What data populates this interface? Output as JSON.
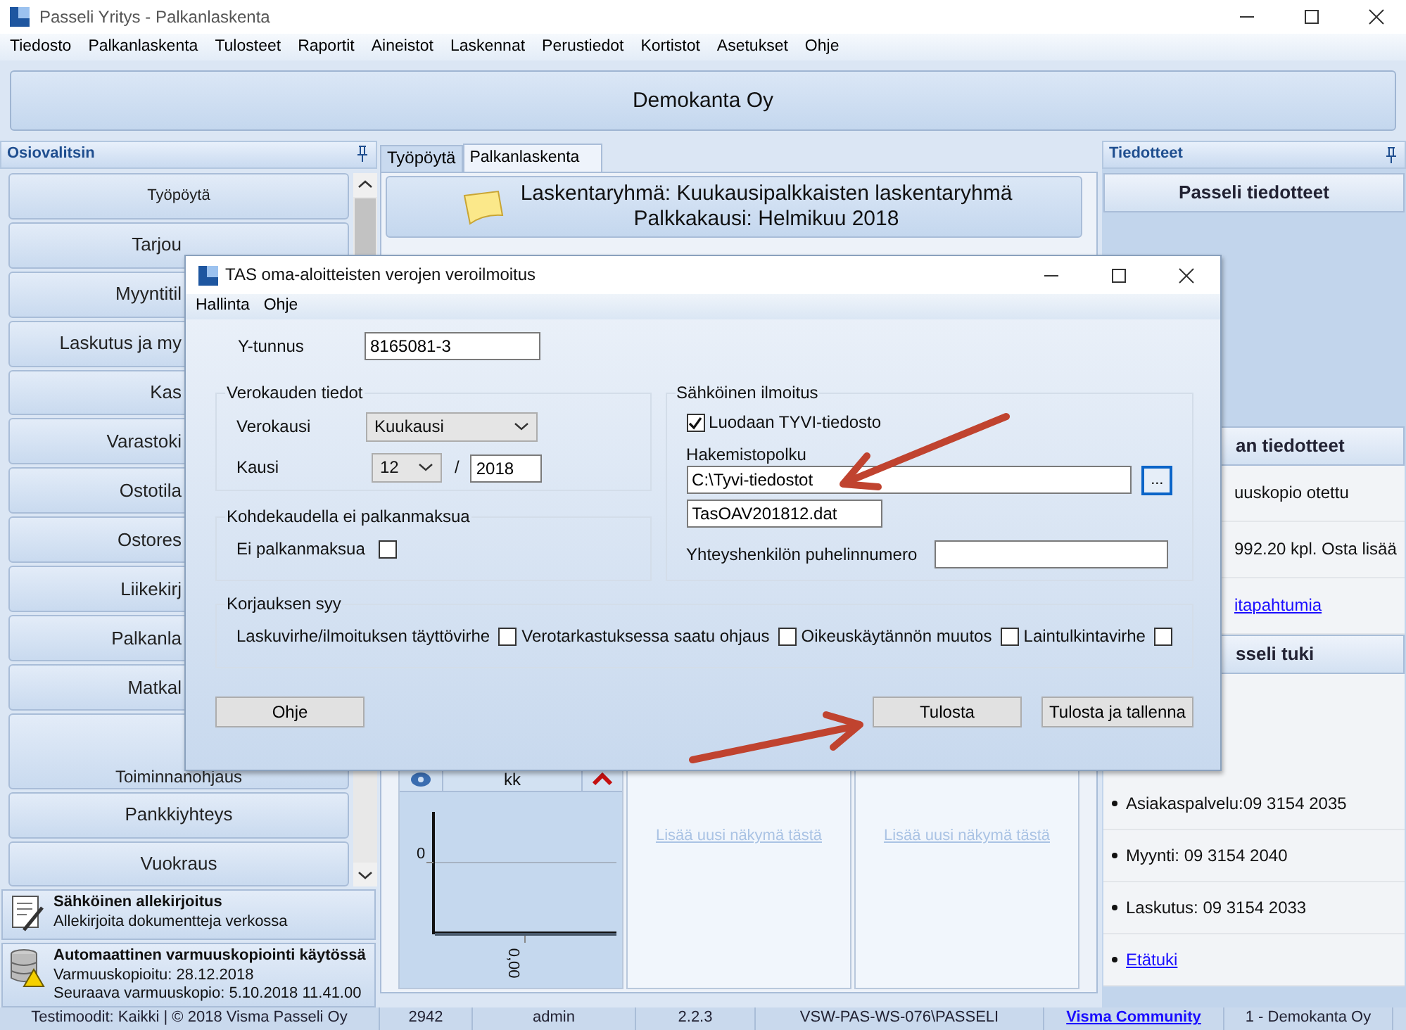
{
  "window": {
    "title": "Passeli Yritys - Palkanlaskenta"
  },
  "menu": [
    "Tiedosto",
    "Palkanlaskenta",
    "Tulosteet",
    "Raportit",
    "Aineistot",
    "Laskennat",
    "Perustiedot",
    "Kortistot",
    "Asetukset",
    "Ohje"
  ],
  "banner": "Demokanta Oy",
  "sidebar": {
    "title": "Osiovalitsin",
    "items": [
      {
        "label": "Työpöytä",
        "kind": "full"
      },
      {
        "label": "Tarjou",
        "kind": "clipped"
      },
      {
        "label": "Myyntitil",
        "kind": "clipped"
      },
      {
        "label": "Laskutus ja my",
        "kind": "clipped"
      },
      {
        "label": "Kas",
        "kind": "clipped"
      },
      {
        "label": "Varastoki",
        "kind": "clipped"
      },
      {
        "label": "Ostotila",
        "kind": "clipped"
      },
      {
        "label": "Ostores",
        "kind": "clipped"
      },
      {
        "label": "Liikekirj",
        "kind": "clipped"
      },
      {
        "label": "Palkanla",
        "kind": "clipped"
      },
      {
        "label": "Matkal",
        "kind": "clipped"
      },
      {
        "label": "Toiminnanohjaus",
        "kind": "clipped_top"
      },
      {
        "label": "Pankkiyhteys",
        "kind": "full"
      },
      {
        "label": "Vuokraus",
        "kind": "full"
      }
    ],
    "notices": [
      {
        "kind": "signature",
        "title": "Sähköinen allekirjoitus",
        "lines": [
          "Allekirjoita dokumentteja verkossa"
        ]
      },
      {
        "kind": "backup",
        "title": "Automaattinen varmuuskopiointi käytössä",
        "lines": [
          "Varmuuskopioitu: 28.12.2018",
          "Seuraava varmuuskopio: 5.10.2018 11.41.00"
        ]
      }
    ]
  },
  "tabs": [
    {
      "label": "Työpöytä",
      "selected": false
    },
    {
      "label": "Palkanlaskenta",
      "selected": true
    }
  ],
  "header": {
    "lines": [
      "Laskentaryhmä: Kuukausipalkkaisten laskentaryhmä",
      "Palkkakausi: Helmikuu 2018"
    ]
  },
  "widgets": [
    {
      "kind": "chart",
      "title": "kk",
      "y_tick": "0",
      "x_label": "0,00"
    },
    {
      "kind": "empty",
      "link": "Lisää uusi näkymä tästä"
    },
    {
      "kind": "empty",
      "link": "Lisää uusi näkymä tästä"
    }
  ],
  "news": {
    "title": "Tiedotteet",
    "sections": [
      {
        "heading": "Passeli tiedotteet",
        "kind": "full"
      },
      {
        "heading": "an tiedotteet",
        "kind": "clipped",
        "rows": [
          {
            "kind": "text",
            "text": "uuskopio otettu"
          },
          {
            "kind": "text",
            "text": "992.20 kpl. Osta lisää"
          },
          {
            "kind": "link",
            "text": "itapahtumia"
          }
        ]
      },
      {
        "heading": "sseli tuki",
        "kind": "clipped",
        "rows": [
          {
            "kind": "bullet",
            "text": "Asiakaspalvelu:09 3154 2035"
          },
          {
            "kind": "bullet",
            "text": "Myynti:  09 3154 2040"
          },
          {
            "kind": "bullet",
            "text": "Laskutus: 09 3154 2033"
          },
          {
            "kind": "bullet_link",
            "text": "Etätuki"
          }
        ]
      }
    ]
  },
  "status_bar": [
    {
      "kind": "text",
      "text": "Testimoodit: Kaikki | © 2018 Visma Passeli Oy"
    },
    {
      "kind": "text",
      "text": "2942"
    },
    {
      "kind": "text",
      "text": "admin"
    },
    {
      "kind": "text",
      "text": "2.2.3"
    },
    {
      "kind": "text",
      "text": "VSW-PAS-WS-076\\PASSELI"
    },
    {
      "kind": "link",
      "text": "Visma Community"
    },
    {
      "kind": "text",
      "text": "1 - Demokanta Oy"
    }
  ],
  "dialog": {
    "title": "TAS oma-aloitteisten verojen veroilmoitus",
    "menu": [
      "Hallinta",
      "Ohje"
    ],
    "business_id": {
      "label": "Y-tunnus",
      "value": "8165081-3"
    },
    "period_group": {
      "title": "Verokauden tiedot",
      "period_type": {
        "label": "Verokausi",
        "value": "Kuukausi"
      },
      "period": {
        "label": "Kausi",
        "month": "12",
        "separator": "/",
        "year": "2018"
      }
    },
    "no_pay_group": {
      "title": "Kohdekaudella ei palkanmaksua",
      "checkbox": {
        "label": "Ei palkanmaksua",
        "checked": false
      }
    },
    "electronic_group": {
      "title": "Sähköinen ilmoitus",
      "create_file": {
        "label": "Luodaan TYVI-tiedosto",
        "checked": true
      },
      "path": {
        "label": "Hakemistopolku",
        "value": "C:\\Tyvi-tiedostot",
        "browse": "..."
      },
      "file_name": "TasOAV201812.dat",
      "phone": {
        "label": "Yhteyshenkilön puhelinnumero"
      }
    },
    "correction_group": {
      "title": "Korjauksen syy",
      "reasons": [
        {
          "label": "Laskuvirhe/ilmoituksen täyttövirhe",
          "checked": false
        },
        {
          "label": "Verotarkastuksessa saatu ohjaus",
          "checked": false
        },
        {
          "label": "Oikeuskäytännön muutos",
          "checked": false
        },
        {
          "label": "Laintulkintavirhe",
          "checked": false
        }
      ]
    },
    "buttons": [
      "Ohje",
      "Tulosta",
      "Tulosta ja tallenna"
    ]
  }
}
